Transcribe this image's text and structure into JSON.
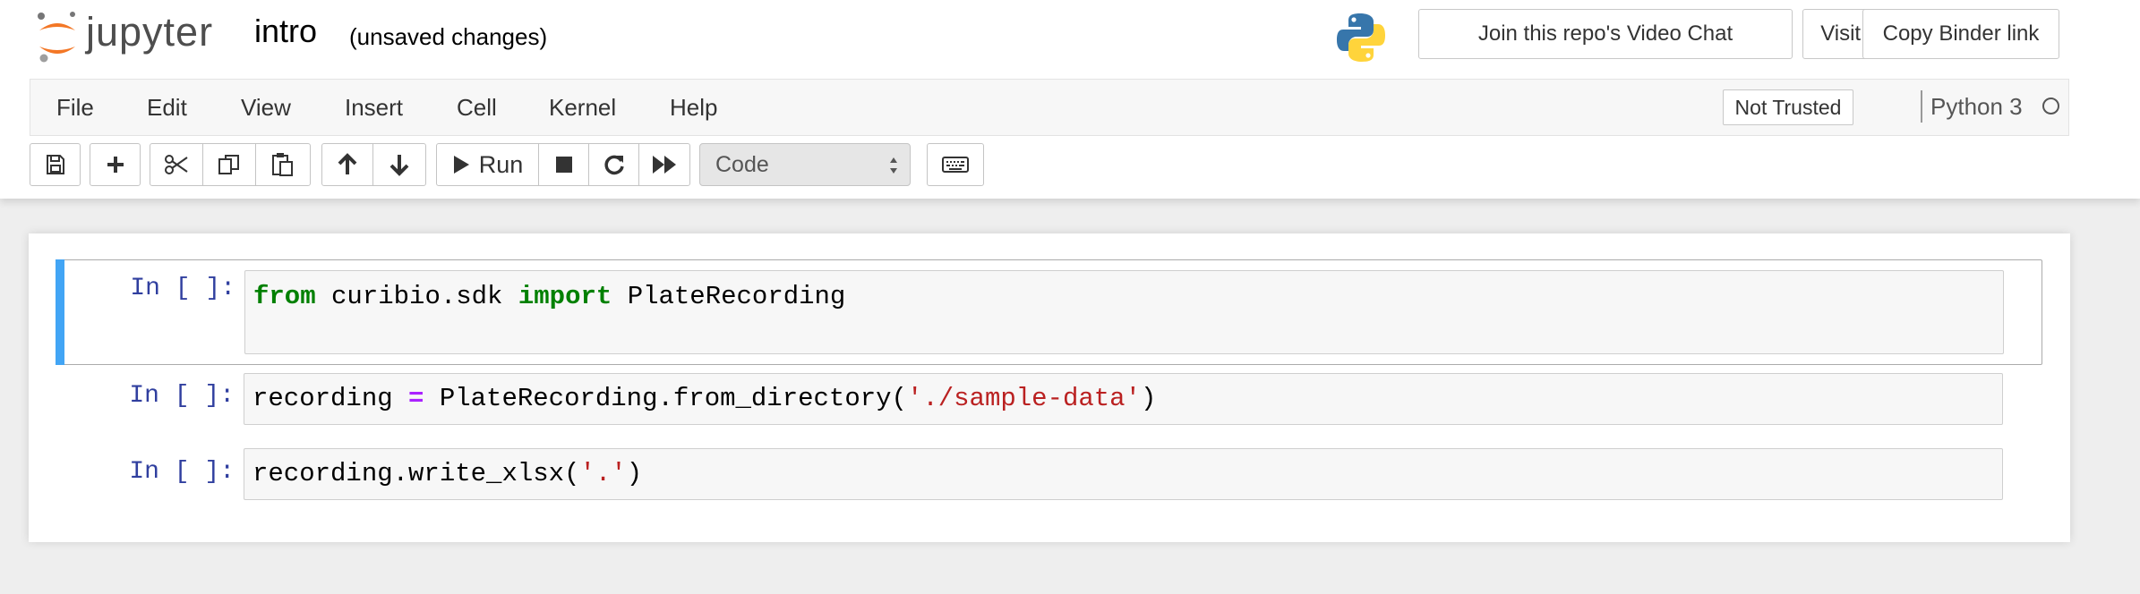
{
  "header": {
    "logo_text": "jupyter",
    "notebook_title": "intro",
    "save_status": "(unsaved changes)",
    "buttons": {
      "video_chat": "Join this repo's Video Chat",
      "visit_repo": "Visit repo",
      "copy_binder": "Copy Binder link"
    }
  },
  "menubar": {
    "items": [
      "File",
      "Edit",
      "View",
      "Insert",
      "Cell",
      "Kernel",
      "Help"
    ],
    "trust_badge": "Not Trusted",
    "kernel_name": "Python 3",
    "kernel_status": "idle"
  },
  "toolbar": {
    "icons": [
      "save-icon",
      "plus-icon",
      "cut-icon",
      "copy-icon",
      "paste-icon",
      "arrow-up-icon",
      "arrow-down-icon",
      "play-icon",
      "stop-icon",
      "restart-icon",
      "fast-forward-icon",
      "keyboard-icon"
    ],
    "run_label": "Run",
    "cell_type": "Code"
  },
  "cells": [
    {
      "prompt": "In [ ]:",
      "tokens": [
        {
          "text": "from",
          "kind": "kw"
        },
        {
          "text": " curibio.sdk ",
          "kind": "plain"
        },
        {
          "text": "import",
          "kind": "kw"
        },
        {
          "text": " PlateRecording",
          "kind": "plain"
        }
      ]
    },
    {
      "prompt": "In [ ]:",
      "tokens": [
        {
          "text": "recording ",
          "kind": "plain"
        },
        {
          "text": "=",
          "kind": "op"
        },
        {
          "text": " PlateRecording.from_directory(",
          "kind": "plain"
        },
        {
          "text": "'./sample-data'",
          "kind": "str"
        },
        {
          "text": ")",
          "kind": "plain"
        }
      ]
    },
    {
      "prompt": "In [ ]:",
      "tokens": [
        {
          "text": "recording.write_xlsx(",
          "kind": "plain"
        },
        {
          "text": "'.'",
          "kind": "str"
        },
        {
          "text": ")",
          "kind": "plain"
        }
      ]
    }
  ],
  "colors": {
    "selected_cell_bar": "#42a5f5",
    "prompt_color": "#303f9f",
    "keyword": "#008000",
    "operator": "#aa22ff",
    "string": "#ba2121",
    "jupyter_orange": "#f37726"
  }
}
